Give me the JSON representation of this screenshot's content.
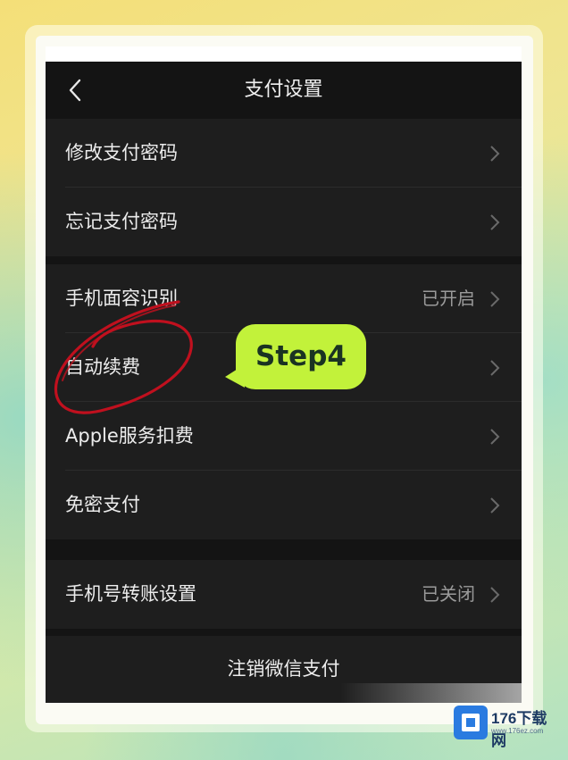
{
  "header": {
    "title": "支付设置",
    "back_icon": "chevron-left-icon"
  },
  "groups": [
    {
      "items": [
        {
          "label": "修改支付密码",
          "value": ""
        },
        {
          "label": "忘记支付密码",
          "value": ""
        }
      ]
    },
    {
      "items": [
        {
          "label": "手机面容识别",
          "value": "已开启"
        },
        {
          "label": "自动续费",
          "value": ""
        },
        {
          "label": "Apple服务扣费",
          "value": ""
        },
        {
          "label": "免密支付",
          "value": ""
        }
      ]
    },
    {
      "items": [
        {
          "label": "手机号转账设置",
          "value": "已关闭"
        }
      ]
    }
  ],
  "footer": {
    "cancel_label": "注销微信支付"
  },
  "annotation": {
    "step_label": "Step4",
    "circle_color": "#c0101e",
    "bubble_color": "#c2f23a"
  },
  "watermark": {
    "name": "176下载网",
    "url": "www.176ez.com",
    "logo_icon": "cube-logo-icon"
  },
  "colors": {
    "background": "#141414",
    "row_background": "#1e1e1e",
    "text": "#ececec",
    "value_text": "#9a9a9a"
  }
}
